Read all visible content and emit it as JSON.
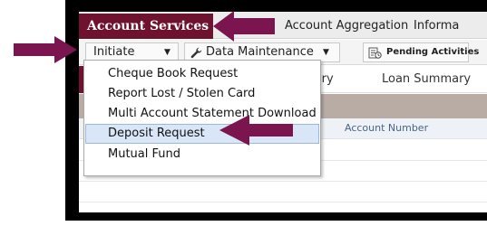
{
  "topnav": {
    "active_tab": "Account Services",
    "tabs": [
      "Account Aggregation",
      "Informa"
    ]
  },
  "toolbar": {
    "initiate_label": "Initiate",
    "data_maintenance_label": "Data Maintenance",
    "pending_label": "Pending Activities",
    "caret": "▼"
  },
  "section_tabs": [
    "mary",
    "Loan Summary"
  ],
  "table": {
    "column_account_number": "Account Number"
  },
  "initiate_menu": {
    "items": [
      "Cheque Book Request",
      "Report Lost / Stolen Card",
      "Multi Account Statement Download",
      "Deposit Request",
      "Mutual Fund"
    ],
    "highlighted_index": 3
  },
  "colors": {
    "brand": "#6e1230",
    "highlight": "#d9e6f8",
    "annotation_arrow": "#7a1550"
  },
  "icons": [
    "wrench-icon",
    "pending-activities-icon"
  ]
}
